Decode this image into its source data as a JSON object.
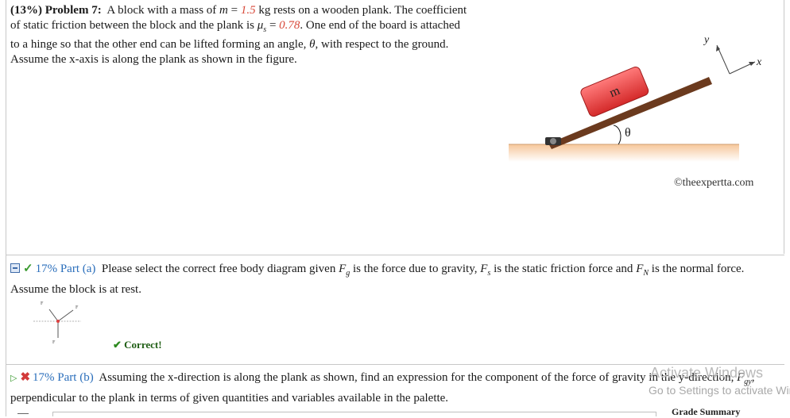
{
  "problem": {
    "header": "(13%) Problem 7:",
    "s1": "A block with a mass of",
    "m_var": "m",
    "eq": " = ",
    "m_val": "1.5",
    "s2": " kg rests on a wooden plank. The coefficient of static friction between the block and the plank is",
    "mu": "μ",
    "mu_sub": "s",
    "mu_val": "0.78",
    "s3": ". One end of the board is attached to a hinge so that the other end can be lifted forming an angle,",
    "theta": "θ",
    "s4": ", with respect to the ground. Assume the x-axis is along the plank as shown in the figure."
  },
  "figure": {
    "block_label": "m",
    "angle_label": "θ",
    "axis_y": "y",
    "axis_x": "x",
    "credit": "©theexpertta.com",
    "colors": {
      "block": "#e63b3b",
      "plank": "#6b3a1e",
      "ground": "#f6c79a"
    }
  },
  "part_a": {
    "title": "17% Part (a)",
    "t1": "Please select the correct free body diagram given",
    "Fg": "F",
    "g": "g",
    "t2": "is the force due to gravity,",
    "Fs": "F",
    "s": "s",
    "t3": "is the static friction force and",
    "FN": "F",
    "N": "N",
    "t4": "is the normal force. Assume the block is at rest.",
    "fbd_fn": "F",
    "fbd_fs": "F",
    "fbd_fg": "F",
    "correct": "Correct!"
  },
  "part_b": {
    "title": "17% Part (b)",
    "t1": "Assuming the x-direction is along the plank as shown, find an expression for the component of the force of gravity in the y-direction,",
    "Fgy": "F",
    "gy": "gy",
    "t2": ", perpendicular to the plank in terms of given quantities and variables available in the palette."
  },
  "watermark": {
    "line1": "Activate Windows",
    "line2": "Go to Settings to activate Windows."
  },
  "grade_summary": "Grade Summary"
}
